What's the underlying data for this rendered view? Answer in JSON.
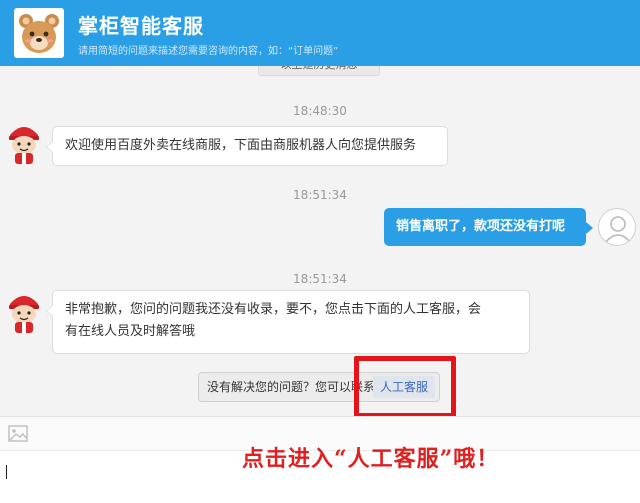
{
  "header": {
    "title": "掌柜智能客服",
    "subtitle": "请用简短的问题来描述您需要咨询的内容，如：“订单问题”"
  },
  "chat": {
    "cut_notice": "以上是历史消息",
    "timestamps": [
      "18:48:30",
      "18:51:34",
      "18:51:34"
    ],
    "bot_message_1": "欢迎使用百度外卖在线商服，下面由商服机器人向您提供服务",
    "user_message": "销售离职了，款项还没有打呢",
    "bot_message_2_line1": "非常抱歉，您问的问题我还没有收录，要不，您点击下面的人工客服，会",
    "bot_message_2_line2": "有在线人员及时解答哦",
    "suggest_text": "没有解决您的问题？您可以联系",
    "suggest_button": "人工客服"
  },
  "annotation": {
    "overlay_text": "点击进入“人工客服”哦！",
    "color": "#e02020"
  },
  "colors": {
    "brand": "#2b9fe6",
    "highlight": "#e5141a"
  },
  "icons": [
    "bear-avatar-icon",
    "bot-avatar-icon",
    "user-avatar-icon",
    "image-icon"
  ]
}
